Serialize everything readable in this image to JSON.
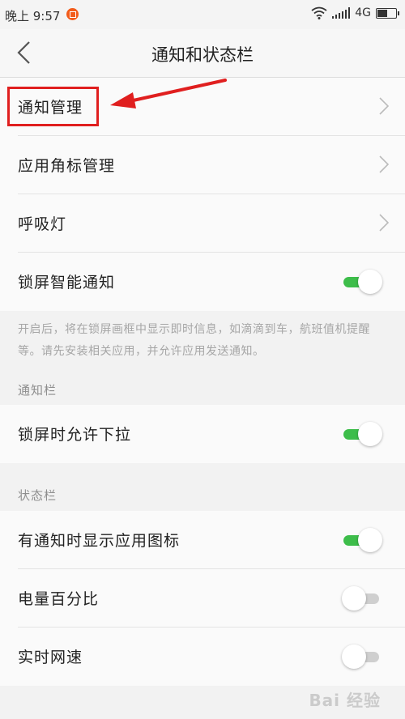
{
  "status_bar": {
    "time": "晚上 9:57",
    "network": "4G"
  },
  "header": {
    "title": "通知和状态栏"
  },
  "items": {
    "notification_management": "通知管理",
    "app_badge_management": "应用角标管理",
    "breathing_light": "呼吸灯",
    "lockscreen_smart_notify": "锁屏智能通知",
    "lockscreen_pulldown": "锁屏时允许下拉",
    "show_app_icon": "有通知时显示应用图标",
    "battery_percent": "电量百分比",
    "realtime_speed": "实时网速"
  },
  "toggles": {
    "lockscreen_smart_notify": true,
    "lockscreen_pulldown": true,
    "show_app_icon": true,
    "battery_percent": false,
    "realtime_speed": false
  },
  "note": "开启后，将在锁屏画框中显示即时信息，如滴滴到车，航班值机提醒等。请先安装相关应用，并允许应用发送通知。",
  "sections": {
    "notification_bar": "通知栏",
    "status_bar": "状态栏"
  },
  "watermark": "Bai 经验",
  "colors": {
    "toggle_on": "#3dbd4a",
    "toggle_off": "#cfcfcf",
    "highlight": "#e01f1f"
  }
}
